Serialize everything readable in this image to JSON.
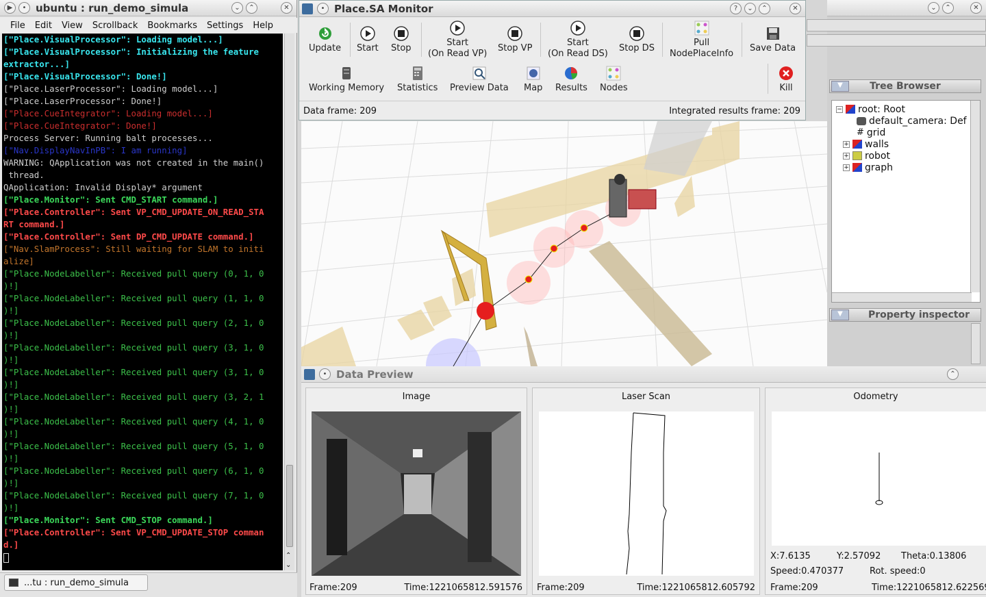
{
  "terminal": {
    "title": "ubuntu : run_demo_simula",
    "menu": [
      "File",
      "Edit",
      "View",
      "Scrollback",
      "Bookmarks",
      "Settings",
      "Help"
    ],
    "lines": [
      {
        "text": "[\"Place.VisualProcessor\": Loading model...]",
        "style": "c-cyan"
      },
      {
        "text": "[\"Place.VisualProcessor\": Initializing the feature",
        "style": "c-cyan"
      },
      {
        "text": "extractor...]",
        "style": "c-cyan"
      },
      {
        "text": "[\"Place.VisualProcessor\": Done!]",
        "style": "c-cyan"
      },
      {
        "text": "[\"Place.LaserProcessor\": Loading model...]",
        "style": "c-white"
      },
      {
        "text": "[\"Place.LaserProcessor\": Done!]",
        "style": "c-white"
      },
      {
        "text": "[\"Place.CueIntegrator\": Loading model...]",
        "style": "c-red"
      },
      {
        "text": "[\"Place.CueIntegrator\": Done!]",
        "style": "c-red"
      },
      {
        "text": "Process Server: Running balt processes...",
        "style": "c-white"
      },
      {
        "text": "[\"Nav.DisplayNavInPB\": I am running]",
        "style": "c-blue"
      },
      {
        "text": "WARNING: QApplication was not created in the main()",
        "style": "c-white"
      },
      {
        "text": " thread.",
        "style": "c-white"
      },
      {
        "text": "QApplication: Invalid Display* argument",
        "style": "c-white"
      },
      {
        "text": "[\"Place.Monitor\": Sent CMD_START command.]",
        "style": "c-green"
      },
      {
        "text": "[\"Place.Controller\": Sent VP_CMD_UPDATE_ON_READ_STA",
        "style": "c-redb"
      },
      {
        "text": "RT command.]",
        "style": "c-redb"
      },
      {
        "text": "[\"Place.Controller\": Sent DP_CMD_UPDATE command.]",
        "style": "c-redb"
      },
      {
        "text": "[\"Nav.SlamProcess\": Still waiting for SLAM to initi",
        "style": "c-orange"
      },
      {
        "text": "alize]",
        "style": "c-orange"
      },
      {
        "text": "[\"Place.NodeLabeller\": Received pull query (0, 1, 0",
        "style": "c-grn"
      },
      {
        "text": ")!]",
        "style": "c-grn"
      },
      {
        "text": "[\"Place.NodeLabeller\": Received pull query (1, 1, 0",
        "style": "c-grn"
      },
      {
        "text": ")!]",
        "style": "c-grn"
      },
      {
        "text": "[\"Place.NodeLabeller\": Received pull query (2, 1, 0",
        "style": "c-grn"
      },
      {
        "text": ")!]",
        "style": "c-grn"
      },
      {
        "text": "[\"Place.NodeLabeller\": Received pull query (3, 1, 0",
        "style": "c-grn"
      },
      {
        "text": ")!]",
        "style": "c-grn"
      },
      {
        "text": "[\"Place.NodeLabeller\": Received pull query (3, 1, 0",
        "style": "c-grn"
      },
      {
        "text": ")!]",
        "style": "c-grn"
      },
      {
        "text": "[\"Place.NodeLabeller\": Received pull query (3, 2, 1",
        "style": "c-grn"
      },
      {
        "text": ")!]",
        "style": "c-grn"
      },
      {
        "text": "[\"Place.NodeLabeller\": Received pull query (4, 1, 0",
        "style": "c-grn"
      },
      {
        "text": ")!]",
        "style": "c-grn"
      },
      {
        "text": "[\"Place.NodeLabeller\": Received pull query (5, 1, 0",
        "style": "c-grn"
      },
      {
        "text": ")!]",
        "style": "c-grn"
      },
      {
        "text": "[\"Place.NodeLabeller\": Received pull query (6, 1, 0",
        "style": "c-grn"
      },
      {
        "text": ")!]",
        "style": "c-grn"
      },
      {
        "text": "[\"Place.NodeLabeller\": Received pull query (7, 1, 0",
        "style": "c-grn"
      },
      {
        "text": ")!]",
        "style": "c-grn"
      },
      {
        "text": "[\"Place.Monitor\": Sent CMD_STOP command.]",
        "style": "c-green"
      },
      {
        "text": "[\"Place.Controller\": Sent VP_CMD_UPDATE_STOP comman",
        "style": "c-redb"
      },
      {
        "text": "d.]",
        "style": "c-redb"
      }
    ],
    "taskbar_tab": "...tu : run_demo_simula"
  },
  "monitor": {
    "title": "Place.SA Monitor",
    "row1": [
      {
        "label1": "Update",
        "label2": "",
        "icon": "refresh-icon"
      },
      {
        "label1": "Start",
        "label2": "",
        "icon": "play-icon"
      },
      {
        "label1": "Stop",
        "label2": "",
        "icon": "stop-icon"
      },
      {
        "label1": "Start",
        "label2": "(On Read VP)",
        "icon": "play-icon"
      },
      {
        "label1": "Stop VP",
        "label2": "",
        "icon": "stop-icon"
      },
      {
        "label1": "Start",
        "label2": "(On Read DS)",
        "icon": "play-icon"
      },
      {
        "label1": "Stop DS",
        "label2": "",
        "icon": "stop-icon"
      },
      {
        "label1": "Pull",
        "label2": "NodePlaceInfo",
        "icon": "nodes-icon"
      },
      {
        "label1": "Save Data",
        "label2": "",
        "icon": "save-icon"
      }
    ],
    "row2": [
      {
        "label": "Working Memory",
        "icon": "memory-icon"
      },
      {
        "label": "Statistics",
        "icon": "statistics-icon"
      },
      {
        "label": "Preview Data",
        "icon": "preview-icon"
      },
      {
        "label": "Map",
        "icon": "map-icon"
      },
      {
        "label": "Results",
        "icon": "results-icon"
      },
      {
        "label": "Nodes",
        "icon": "nodes-icon"
      },
      {
        "label": "Kill",
        "icon": "kill-icon"
      }
    ],
    "data_frame": "Data frame: 209",
    "integrated_frame": "Integrated results frame: 209"
  },
  "tree_browser": {
    "title": "Tree Browser",
    "items": [
      {
        "label": "root: Root",
        "icon": "root-icon"
      },
      {
        "label": "default_camera: Def",
        "icon": "camera-icon"
      },
      {
        "label": "grid",
        "icon": "grid-icon"
      },
      {
        "label": "walls",
        "icon": "walls-icon"
      },
      {
        "label": "robot",
        "icon": "robot-icon"
      },
      {
        "label": "graph",
        "icon": "graph-icon"
      }
    ],
    "property_inspector": "Property inspector"
  },
  "preview": {
    "title": "Data Preview",
    "image": {
      "title": "Image",
      "frame": "Frame:209",
      "time": "Time:1221065812.591576"
    },
    "laser": {
      "title": "Laser Scan",
      "frame": "Frame:209",
      "time": "Time:1221065812.605792"
    },
    "odometry": {
      "title": "Odometry",
      "x": "X:7.6135",
      "y": "Y:2.57092",
      "theta": "Theta:0.13806",
      "speed": "Speed:0.470377",
      "rot_speed": "Rot. speed:0",
      "frame": "Frame:209",
      "time": "Time:1221065812.622569"
    }
  }
}
